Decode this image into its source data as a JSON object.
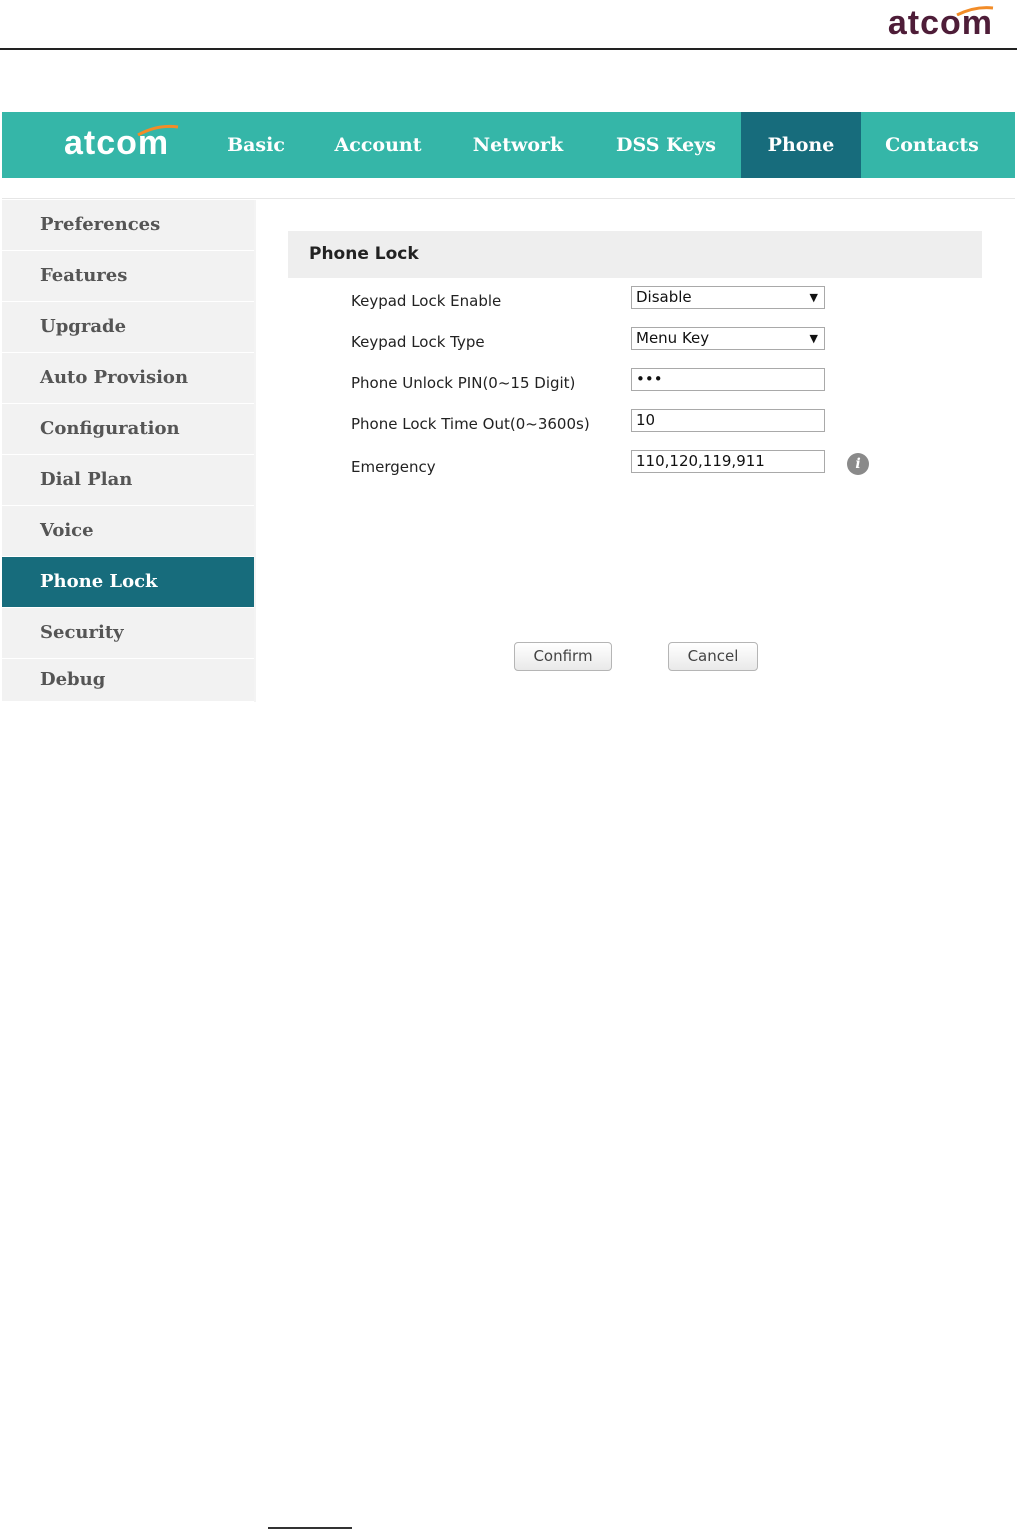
{
  "doc_header": {
    "logo": "atcom"
  },
  "app": {
    "logo": "atcom",
    "nav_tabs": [
      {
        "label": "Basic"
      },
      {
        "label": "Account"
      },
      {
        "label": "Network"
      },
      {
        "label": "DSS Keys"
      },
      {
        "label": "Phone",
        "active": true
      },
      {
        "label": "Contacts"
      }
    ],
    "sidebar_items": [
      {
        "label": "Preferences"
      },
      {
        "label": "Features"
      },
      {
        "label": "Upgrade"
      },
      {
        "label": "Auto Provision"
      },
      {
        "label": "Configuration"
      },
      {
        "label": "Dial Plan"
      },
      {
        "label": "Voice"
      },
      {
        "label": "Phone Lock",
        "active": true
      },
      {
        "label": "Security"
      },
      {
        "label": "Debug"
      }
    ],
    "panel": {
      "title": "Phone Lock",
      "fields": {
        "keypad_lock_enable": {
          "label": "Keypad Lock Enable",
          "value": "Disable"
        },
        "keypad_lock_type": {
          "label": "Keypad Lock Type",
          "value": "Menu Key"
        },
        "unlock_pin": {
          "label": "Phone Unlock PIN(0~15 Digit)",
          "value": "•••"
        },
        "lock_timeout": {
          "label": "Phone Lock Time Out(0~3600s)",
          "value": "10"
        },
        "emergency": {
          "label": "Emergency",
          "value": "110,120,119,911"
        }
      },
      "confirm_label": "Confirm",
      "cancel_label": "Cancel"
    }
  },
  "colors": {
    "nav_bg": "#35b6a8",
    "active_bg": "#176c7c",
    "logo_dark": "#4e1d38",
    "logo_accent": "#f28c28"
  },
  "icons": {
    "select_arrow": "chevron-down-icon",
    "info": "info-icon"
  }
}
